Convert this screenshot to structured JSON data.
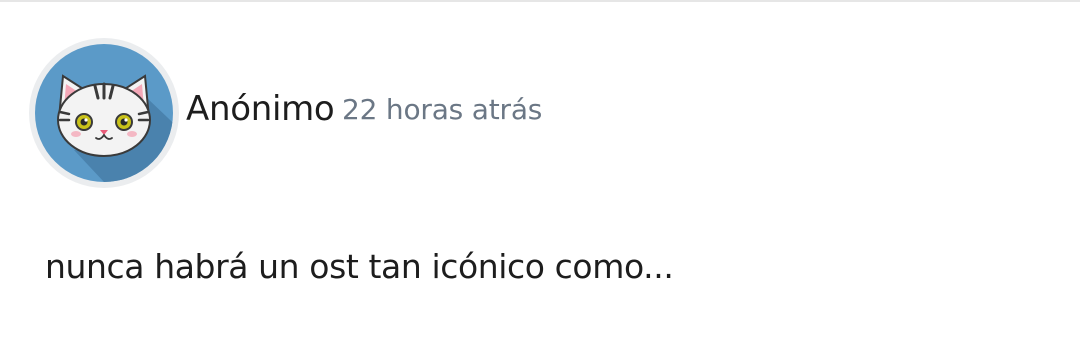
{
  "comment": {
    "author": "Anónimo",
    "timestamp": "22 horas atrás",
    "text": "nunca habrá un ost tan icónico como...",
    "avatar_icon": "cat-avatar-icon"
  },
  "colors": {
    "avatar_ring": "#ebedef",
    "avatar_bg": "#5b9ac8",
    "avatar_shadow": "#4a82ad",
    "timestamp": "#6b7785",
    "text": "#1d1d1d"
  }
}
